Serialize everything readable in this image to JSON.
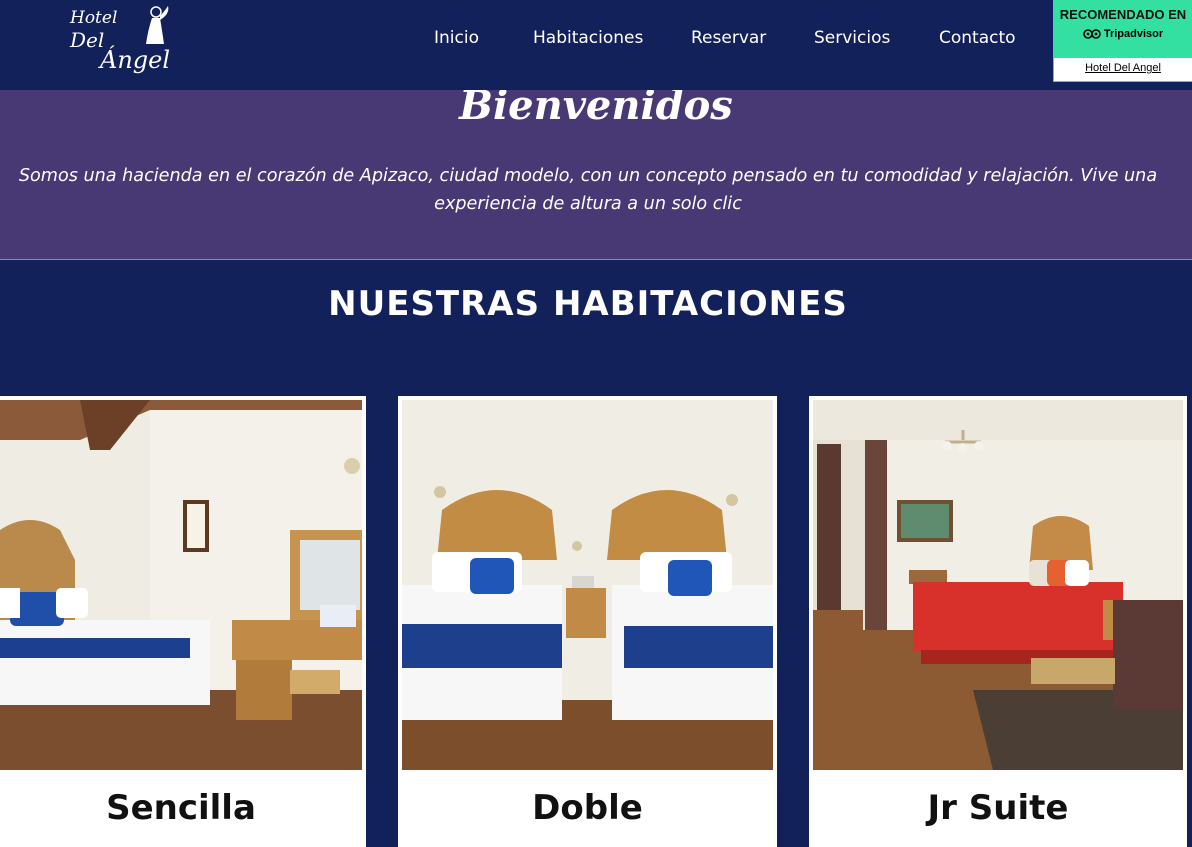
{
  "header": {
    "logo": {
      "hotel": "Hotel",
      "del": "Del",
      "angel": "Ángel"
    },
    "nav": [
      "Inicio",
      "Habitaciones",
      "Reservar",
      "Servicios",
      "Contacto"
    ],
    "tripadvisor": {
      "title": "RECOMENDADO EN",
      "brand": "Tripadvisor",
      "link": "Hotel Del Angel",
      "accent": "#34e0a1"
    }
  },
  "welcome": {
    "title": "Bienvenidos",
    "text": "Somos una hacienda en el corazón de Apizaco, ciudad modelo, con un concepto pensado en tu comodidad y relajación. Vive una experiencia de altura a un solo clic"
  },
  "rooms": {
    "title": "NUESTRAS HABITACIONES",
    "items": [
      {
        "name": "Sencilla"
      },
      {
        "name": "Doble"
      },
      {
        "name": "Jr Suite"
      }
    ]
  },
  "colors": {
    "navy": "#13215a",
    "purple": "#483873"
  }
}
